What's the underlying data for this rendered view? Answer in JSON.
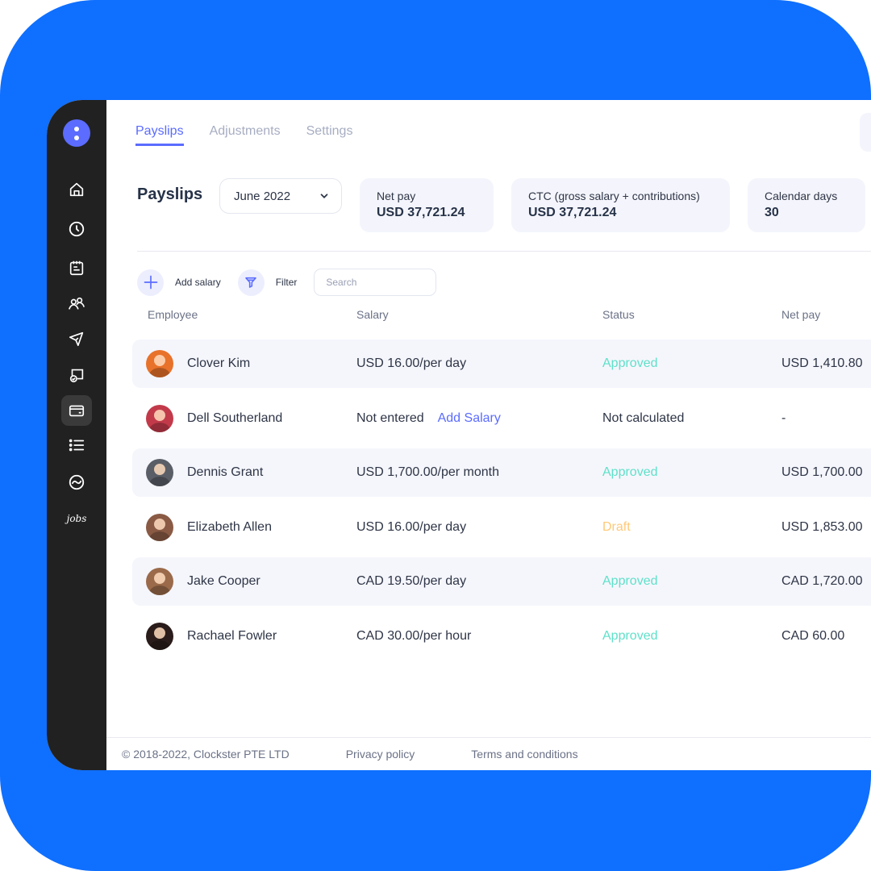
{
  "brand": {
    "accent": "#5b6cff",
    "frame": "#0f6fff",
    "sidebar_bg": "#212121"
  },
  "sidebar": {
    "items": [
      {
        "icon": "home-icon",
        "label": "Home",
        "active": false
      },
      {
        "icon": "clock-icon",
        "label": "Time",
        "active": false
      },
      {
        "icon": "calendar-notes-icon",
        "label": "Schedule",
        "active": false
      },
      {
        "icon": "people-icon",
        "label": "People",
        "active": false
      },
      {
        "icon": "plane-icon",
        "label": "Time off",
        "active": false
      },
      {
        "icon": "monitor-check-icon",
        "label": "Approvals",
        "active": false
      },
      {
        "icon": "credit-card-icon",
        "label": "Payroll",
        "active": true
      },
      {
        "icon": "list-icon",
        "label": "Lists",
        "active": false
      },
      {
        "icon": "yin-yang-icon",
        "label": "Integrations",
        "active": false
      },
      {
        "icon": "jobs-icon",
        "label": "jobs",
        "active": false
      }
    ]
  },
  "tabs": [
    {
      "label": "Payslips",
      "active": true
    },
    {
      "label": "Adjustments",
      "active": false
    },
    {
      "label": "Settings",
      "active": false
    }
  ],
  "header": {
    "title": "Payslips",
    "month_select": "June 2022",
    "stats": [
      {
        "label": "Net pay",
        "value": "USD 37,721.24"
      },
      {
        "label": "CTC (gross salary + contributions)",
        "value": "USD 37,721.24"
      },
      {
        "label": "Calendar days",
        "value": "30"
      }
    ]
  },
  "toolbar": {
    "add_salary_label": "Add salary",
    "filter_label": "Filter",
    "search_placeholder": "Search"
  },
  "table": {
    "columns": [
      "Employee",
      "Salary",
      "Status",
      "Net pay"
    ],
    "rows": [
      {
        "employee": "Clover Kim",
        "salary": "USD 16.00/per day",
        "salary_link": "",
        "status": "Approved",
        "status_type": "approved",
        "net_pay": "USD 1,410.80",
        "avatar_color": "#e8722a"
      },
      {
        "employee": "Dell Southerland",
        "salary": "Not entered",
        "salary_link": "Add Salary",
        "status": "Not calculated",
        "status_type": "neutral",
        "net_pay": "-",
        "avatar_color": "#c23a4a"
      },
      {
        "employee": "Dennis Grant",
        "salary": "USD 1,700.00/per month",
        "salary_link": "",
        "status": "Approved",
        "status_type": "approved",
        "net_pay": "USD 1,700.00",
        "avatar_color": "#5a5e66"
      },
      {
        "employee": "Elizabeth Allen",
        "salary": "USD 16.00/per day",
        "salary_link": "",
        "status": "Draft",
        "status_type": "draft",
        "net_pay": "USD 1,853.00",
        "avatar_color": "#8a5a44"
      },
      {
        "employee": "Jake Cooper",
        "salary": "CAD 19.50/per day",
        "salary_link": "",
        "status": "Approved",
        "status_type": "approved",
        "net_pay": "CAD 1,720.00",
        "avatar_color": "#9a6a4a"
      },
      {
        "employee": "Rachael Fowler",
        "salary": "CAD 30.00/per hour",
        "salary_link": "",
        "status": "Approved",
        "status_type": "approved",
        "net_pay": "CAD 60.00",
        "avatar_color": "#2a1c1a"
      }
    ]
  },
  "footer": {
    "copyright": "© 2018-2022, Clockster PTE LTD",
    "privacy": "Privacy policy",
    "terms": "Terms and conditions"
  }
}
